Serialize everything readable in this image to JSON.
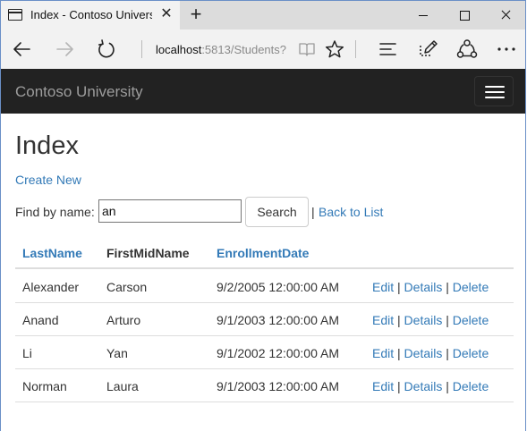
{
  "browser": {
    "tab_title": "Index - Contoso Univers",
    "tab_close": "✕",
    "new_tab": "+",
    "url_host": "localhost",
    "url_rest": ":5813/Students?"
  },
  "navbar": {
    "brand": "Contoso University"
  },
  "page": {
    "title": "Index",
    "create_link": "Create New",
    "find_label": "Find by name:",
    "search_value": "an",
    "search_button": "Search",
    "separator": "|",
    "back_link": "Back to List"
  },
  "table": {
    "headers": [
      "LastName",
      "FirstMidName",
      "EnrollmentDate"
    ],
    "actions": {
      "edit": "Edit",
      "details": "Details",
      "delete": "Delete",
      "sep": "|"
    },
    "rows": [
      {
        "last": "Alexander",
        "first": "Carson",
        "date": "9/2/2005 12:00:00 AM"
      },
      {
        "last": "Anand",
        "first": "Arturo",
        "date": "9/1/2003 12:00:00 AM"
      },
      {
        "last": "Li",
        "first": "Yan",
        "date": "9/1/2002 12:00:00 AM"
      },
      {
        "last": "Norman",
        "first": "Laura",
        "date": "9/1/2003 12:00:00 AM"
      }
    ]
  },
  "colors": {
    "link": "#337ab7",
    "navbar_bg": "#222222",
    "brand_text": "#9d9d9d",
    "chrome_bg": "#f2f2f2"
  }
}
